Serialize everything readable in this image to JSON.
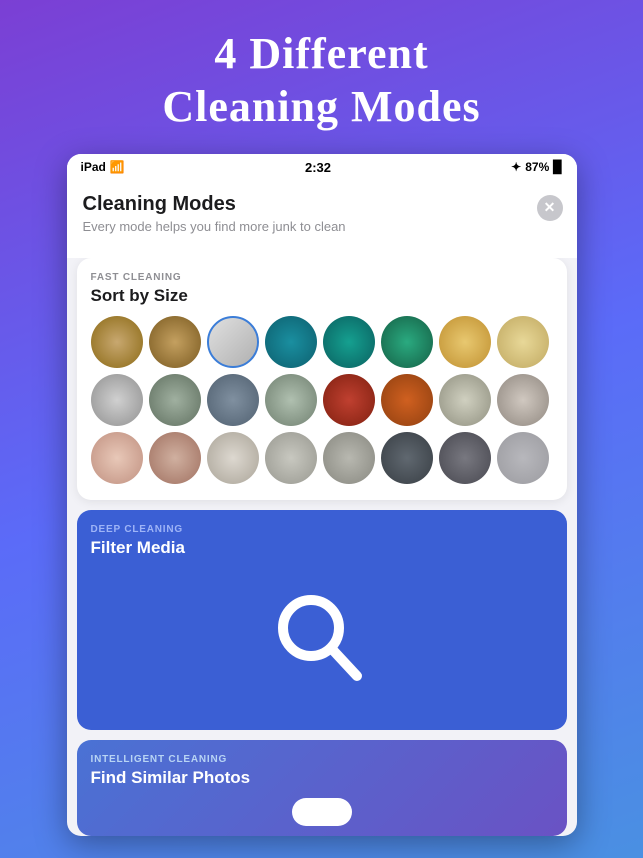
{
  "header": {
    "title_line1": "4 Different",
    "title_line2": "Cleaning Modes"
  },
  "statusBar": {
    "device": "iPad",
    "wifi": "wifi",
    "time": "2:32",
    "bluetooth": "✦",
    "battery": "87%"
  },
  "appHeader": {
    "title": "Cleaning Modes",
    "subtitle": "Every mode helps you find more junk to clean",
    "closeLabel": "×"
  },
  "fastCleaningCard": {
    "label": "FAST CLEANING",
    "title": "Sort by Size"
  },
  "deepCleaningCard": {
    "label": "DEEP CLEANING",
    "title": "Filter Media"
  },
  "intelligentCleaningCard": {
    "label": "INTELLIGENT CLEANING",
    "title": "Find Similar Photos"
  }
}
